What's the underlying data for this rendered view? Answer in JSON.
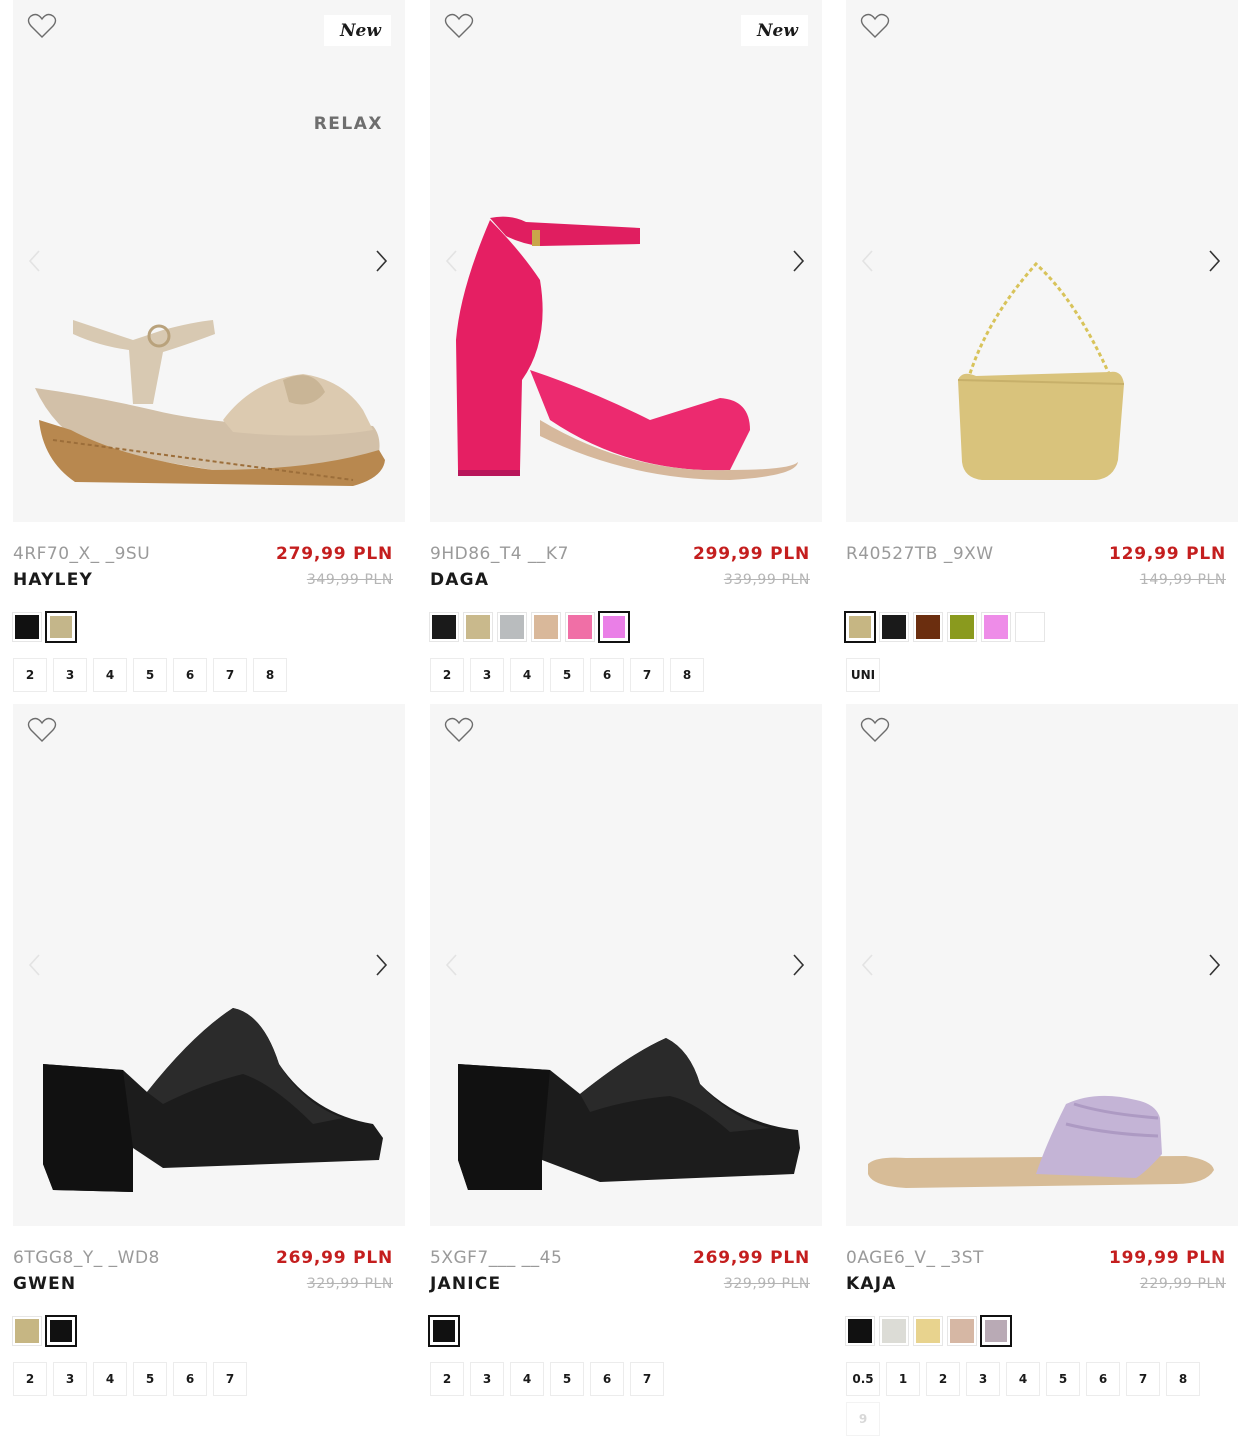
{
  "products": [
    {
      "sku": "4RF70_X_ _9SU",
      "name": "HAYLEY",
      "price": "279,99 PLN",
      "old_price": "349,99 PLN",
      "badge": "New",
      "brand_tag": "RELAX",
      "colors": [
        "#111111",
        "#c4b68a"
      ],
      "selected_color": 1,
      "sizes": [
        "2",
        "3",
        "4",
        "5",
        "6",
        "7",
        "8"
      ],
      "image": "beige-wedge-sandal"
    },
    {
      "sku": "9HD86_T4 __K7",
      "name": "DAGA",
      "price": "299,99 PLN",
      "old_price": "339,99 PLN",
      "badge": "New",
      "colors": [
        "#1a1a1a",
        "#c9b98c",
        "#b9bcbe",
        "#d9b89a",
        "#f06fa6",
        "#ea7fe7"
      ],
      "selected_color": 5,
      "sizes": [
        "2",
        "3",
        "4",
        "5",
        "6",
        "7",
        "8"
      ],
      "image": "pink-block-heel-sandal"
    },
    {
      "sku": "R40527TB _9XW",
      "name": "",
      "price": "129,99 PLN",
      "old_price": "149,99 PLN",
      "colors": [
        "#c6b683",
        "#1a1a1a",
        "#6b2e0f",
        "#8a9a1e",
        "#ee8ce8",
        "#ffffff"
      ],
      "selected_color": 0,
      "sizes": [
        "UNI"
      ],
      "image": "yellow-chain-bag"
    },
    {
      "sku": "6TGG8_Y_ _WD8",
      "name": "GWEN",
      "price": "269,99 PLN",
      "old_price": "329,99 PLN",
      "colors": [
        "#c6b683",
        "#111111"
      ],
      "selected_color": 1,
      "sizes": [
        "2",
        "3",
        "4",
        "5",
        "6",
        "7"
      ],
      "image": "black-heel-mule"
    },
    {
      "sku": "5XGF7___ __45",
      "name": "JANICE",
      "price": "269,99 PLN",
      "old_price": "329,99 PLN",
      "colors": [
        "#111111"
      ],
      "selected_color": 0,
      "sizes": [
        "2",
        "3",
        "4",
        "5",
        "6",
        "7"
      ],
      "image": "black-platform-mule"
    },
    {
      "sku": "0AGE6_V_ _3ST",
      "name": "KAJA",
      "price": "199,99 PLN",
      "old_price": "229,99 PLN",
      "colors": [
        "#111111",
        "#dcdcd6",
        "#e8d38e",
        "#d6b7a4",
        "#b9aab5"
      ],
      "selected_color": 4,
      "sizes": [
        "0.5",
        "1",
        "2",
        "3",
        "4",
        "5",
        "6",
        "7",
        "8",
        "9"
      ],
      "faded_sizes": [
        "9"
      ],
      "image": "lilac-slide-sandal"
    }
  ],
  "icons": {
    "wishlist": "heart-outline-icon",
    "prev": "chevron-left-icon",
    "next": "chevron-right-icon"
  }
}
